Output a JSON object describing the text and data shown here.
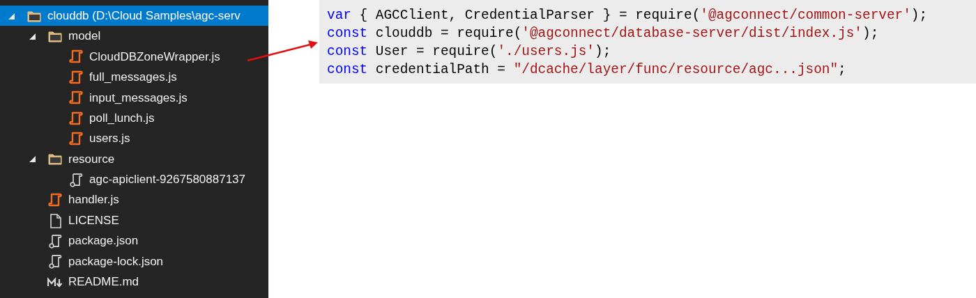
{
  "explorer": {
    "tree": [
      {
        "label": "clouddb (D:\\Cloud Samples\\agc-serv",
        "kind": "folder",
        "selected": true,
        "expanded": true,
        "children": [
          {
            "label": "model",
            "kind": "folder",
            "selected": false,
            "expanded": true,
            "children": [
              {
                "label": "CloudDBZoneWrapper.js",
                "kind": "js",
                "selected": false
              },
              {
                "label": "full_messages.js",
                "kind": "js",
                "selected": false
              },
              {
                "label": "input_messages.js",
                "kind": "js",
                "selected": false
              },
              {
                "label": "poll_lunch.js",
                "kind": "js",
                "selected": false
              },
              {
                "label": "users.js",
                "kind": "js",
                "selected": false
              }
            ]
          },
          {
            "label": "resource",
            "kind": "folder",
            "selected": false,
            "expanded": true,
            "children": [
              {
                "label": "agc-apiclient-9267580887137",
                "kind": "json",
                "selected": false
              }
            ]
          },
          {
            "label": "handler.js",
            "kind": "js",
            "selected": false
          },
          {
            "label": "LICENSE",
            "kind": "file",
            "selected": false
          },
          {
            "label": "package.json",
            "kind": "json",
            "selected": false
          },
          {
            "label": "package-lock.json",
            "kind": "json",
            "selected": false
          },
          {
            "label": "README.md",
            "kind": "markdown",
            "selected": false
          }
        ]
      }
    ]
  },
  "code": {
    "lines": [
      [
        {
          "kind": "keyword",
          "text": "var"
        },
        {
          "kind": "plain",
          "text": " { AGCClient, CredentialParser } = require("
        },
        {
          "kind": "string",
          "text": "'@agconnect/common-server'"
        },
        {
          "kind": "plain",
          "text": ");"
        }
      ],
      [
        {
          "kind": "keyword",
          "text": "const"
        },
        {
          "kind": "plain",
          "text": " clouddb = require("
        },
        {
          "kind": "string",
          "text": "'@agconnect/database-server/dist/index.js'"
        },
        {
          "kind": "plain",
          "text": ");"
        }
      ],
      [
        {
          "kind": "keyword",
          "text": "const"
        },
        {
          "kind": "plain",
          "text": " User = require("
        },
        {
          "kind": "string",
          "text": "'./users.js'"
        },
        {
          "kind": "plain",
          "text": ");"
        }
      ],
      [
        {
          "kind": "keyword",
          "text": "const"
        },
        {
          "kind": "plain",
          "text": " credentialPath = "
        },
        {
          "kind": "string",
          "text": "\"/dcache/layer/func/resource/agc...json\""
        },
        {
          "kind": "plain",
          "text": ";"
        }
      ]
    ]
  }
}
